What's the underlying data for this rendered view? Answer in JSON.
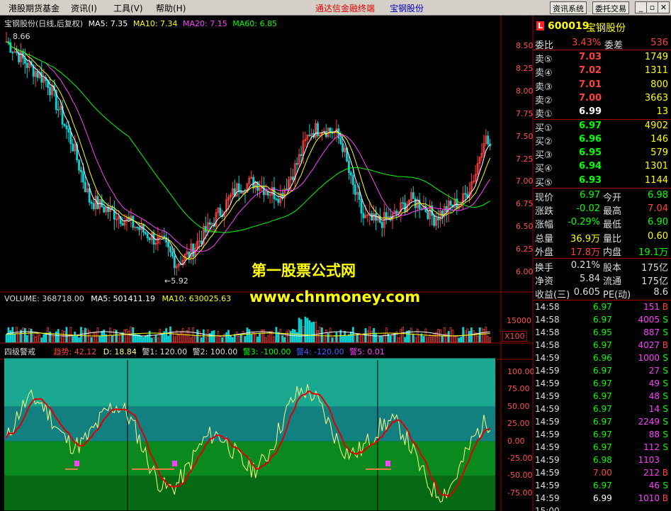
{
  "menu": {
    "items": [
      "港股期货基金",
      "资讯(I)",
      "工具(V)",
      "帮助(H)"
    ],
    "center_title_red": "通达信金融终端",
    "center_title_blue": "宝钢股份",
    "btn_info": "资讯系统",
    "btn_trade": "委托交易"
  },
  "colors": {
    "bg": "#000000",
    "up": "#ff4040",
    "down": "#00d8d8",
    "ma5": "#ffffff",
    "ma10": "#ffff00",
    "ma20": "#ff40ff",
    "ma60": "#00ff00",
    "grid": "#a00000"
  },
  "price_chart": {
    "legend": {
      "name": "宝钢股份(日线,后复权)",
      "ma5": "MA5: 7.35",
      "ma10": "MA10: 7.34",
      "ma20": "MA20: 7.15",
      "ma60": "MA60: 6.85"
    },
    "high_mark": "8.66",
    "low_mark": "5.92",
    "y_ticks": [
      "8.50",
      "8.25",
      "8.00",
      "7.75",
      "7.50",
      "7.25",
      "7.00",
      "6.75",
      "6.50",
      "6.25",
      "6.00"
    ]
  },
  "volume_chart": {
    "legend": {
      "vol": "VOLUME: 368718.00",
      "ma5": "MA5: 501411.19",
      "ma10": "MA10: 630025.63"
    },
    "y_tick": "15000",
    "unit": "X100"
  },
  "indicator_chart": {
    "legend": {
      "name": "四级警戒",
      "trend": "趋势: 42.12",
      "d": "D: 18.84",
      "w1": "警1: 120.00",
      "w2": "警2: 100.00",
      "w3": "警3: -100.00",
      "w4": "警4: -120.00",
      "w5": "警5: 0.01"
    },
    "y_ticks": [
      "100.00",
      "75.00",
      "50.00",
      "25.00",
      "0.00",
      "-25.00",
      "-50.00",
      "-75.00"
    ]
  },
  "watermark": {
    "line1": "第一股票公式网",
    "line2": "www.chnmoney.com"
  },
  "quote": {
    "code": "600019",
    "name": "宝钢股份",
    "badge": "L",
    "weibi_label": "委比",
    "weibi": "3.43%",
    "weicha_label": "委差",
    "weicha": "536",
    "asks": [
      {
        "label": "卖⑤",
        "price": "7.03",
        "vol": "1749"
      },
      {
        "label": "卖④",
        "price": "7.02",
        "vol": "1311"
      },
      {
        "label": "卖③",
        "price": "7.01",
        "vol": "800"
      },
      {
        "label": "卖②",
        "price": "7.00",
        "vol": "3663"
      },
      {
        "label": "卖①",
        "price": "6.99",
        "vol": "13"
      }
    ],
    "bids": [
      {
        "label": "买①",
        "price": "6.97",
        "vol": "4902"
      },
      {
        "label": "买②",
        "price": "6.96",
        "vol": "146"
      },
      {
        "label": "买③",
        "price": "6.95",
        "vol": "579"
      },
      {
        "label": "买④",
        "price": "6.94",
        "vol": "1301"
      },
      {
        "label": "买⑤",
        "price": "6.93",
        "vol": "1144"
      }
    ],
    "stats": [
      {
        "l1": "现价",
        "v1": "6.97",
        "l2": "今开",
        "v2": "6.98",
        "c1": "#00ff00",
        "c2": "#00ff00"
      },
      {
        "l1": "涨跌",
        "v1": "-0.02",
        "l2": "最高",
        "v2": "7.04",
        "c1": "#00ff00",
        "c2": "#ff4040"
      },
      {
        "l1": "涨幅",
        "v1": "-0.29%",
        "l2": "最低",
        "v2": "6.90",
        "c1": "#00ff00",
        "c2": "#00ff00"
      },
      {
        "l1": "总量",
        "v1": "36.9万",
        "l2": "量比",
        "v2": "0.60",
        "c1": "#ffff00",
        "c2": "#ffff00"
      },
      {
        "l1": "外盘",
        "v1": "17.8万",
        "l2": "内盘",
        "v2": "19.1万",
        "c1": "#ff4040",
        "c2": "#00ff00"
      }
    ],
    "stats2": [
      {
        "l1": "换手",
        "v1": "0.21%",
        "l2": "股本",
        "v2": "175亿"
      },
      {
        "l1": "净资",
        "v1": "5.84",
        "l2": "流通",
        "v2": "175亿"
      },
      {
        "l1": "收益(三)",
        "v1": "0.605",
        "l2": "PE(动)",
        "v2": "8.6"
      }
    ],
    "ticks": [
      {
        "t": "14:58",
        "p": "6.97",
        "v": "151",
        "s": "B"
      },
      {
        "t": "14:58",
        "p": "6.97",
        "v": "4005",
        "s": "S"
      },
      {
        "t": "14:58",
        "p": "6.95",
        "v": "887",
        "s": "S"
      },
      {
        "t": "14:58",
        "p": "6.97",
        "v": "4027",
        "s": "B"
      },
      {
        "t": "14:59",
        "p": "6.96",
        "v": "1000",
        "s": "S"
      },
      {
        "t": "14:59",
        "p": "6.97",
        "v": "27",
        "s": "S"
      },
      {
        "t": "14:59",
        "p": "6.97",
        "v": "49",
        "s": "S"
      },
      {
        "t": "14:59",
        "p": "6.97",
        "v": "48",
        "s": "S"
      },
      {
        "t": "14:59",
        "p": "6.97",
        "v": "14",
        "s": "S"
      },
      {
        "t": "14:59",
        "p": "6.97",
        "v": "2249",
        "s": "S"
      },
      {
        "t": "14:59",
        "p": "6.97",
        "v": "88",
        "s": "S"
      },
      {
        "t": "14:59",
        "p": "6.97",
        "v": "112",
        "s": "S"
      },
      {
        "t": "14:59",
        "p": "6.98",
        "v": "1103",
        "s": ""
      },
      {
        "t": "14:59",
        "p": "7.00",
        "v": "212",
        "s": "B"
      },
      {
        "t": "14:59",
        "p": "6.97",
        "v": "46",
        "s": "S"
      },
      {
        "t": "14:59",
        "p": "6.99",
        "v": "1010",
        "s": "B"
      },
      {
        "t": "15:00",
        "p": "",
        "v": "",
        "s": ""
      }
    ]
  }
}
